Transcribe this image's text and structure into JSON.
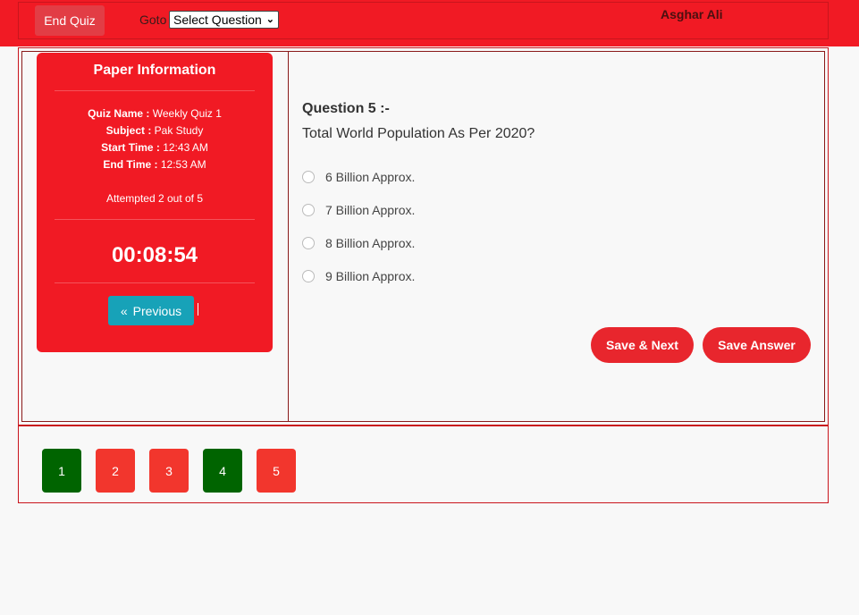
{
  "topbar": {
    "end_quiz_label": "End Quiz",
    "goto_label": "Goto",
    "select_value": "Select Question",
    "user_name": "Asghar Ali",
    "bg_color": "#f11a24"
  },
  "paper_info": {
    "title": "Paper Information",
    "quiz_name_key": "Quiz Name :",
    "quiz_name_value": " Weekly Quiz 1",
    "subject_key": "Subject :",
    "subject_value": " Pak Study",
    "start_time_key": "Start Time :",
    "start_time_value": " 12:43 AM",
    "end_time_key": "End Time :",
    "end_time_value": " 12:53 AM",
    "attempted": "Attempted 2 out of 5",
    "timer": "00:08:54",
    "previous_label": "Previous",
    "previous_icon": "«"
  },
  "question": {
    "number_label": "Question 5 :-",
    "text": "Total World Population As Per 2020?",
    "options": [
      "6 Billion Approx.",
      "7 Billion Approx.",
      "8 Billion Approx.",
      "9 Billion Approx."
    ],
    "save_next_label": "Save & Next",
    "save_answer_label": "Save Answer"
  },
  "navigation": {
    "buttons": [
      {
        "label": "1",
        "status": "answered",
        "color": "#006400"
      },
      {
        "label": "2",
        "status": "unanswered",
        "color": "#f2362d"
      },
      {
        "label": "3",
        "status": "unanswered",
        "color": "#f2362d"
      },
      {
        "label": "4",
        "status": "answered",
        "color": "#006400"
      },
      {
        "label": "5",
        "status": "unanswered",
        "color": "#f2362d"
      }
    ]
  }
}
